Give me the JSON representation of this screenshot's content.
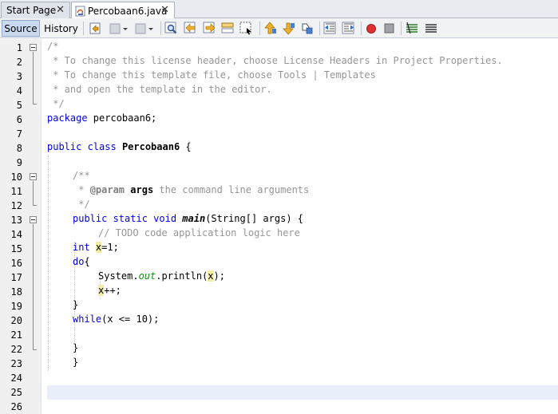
{
  "tabs": [
    {
      "label": "Start Page",
      "close": "✕"
    },
    {
      "label": "Percobaan6.java",
      "close": "✕"
    }
  ],
  "toolbar": {
    "source_label": "Source",
    "history_label": "History"
  },
  "line_numbers": [
    "1",
    "2",
    "3",
    "4",
    "5",
    "6",
    "7",
    "8",
    "9",
    "10",
    "11",
    "12",
    "13",
    "14",
    "15",
    "16",
    "17",
    "18",
    "19",
    "20",
    "21",
    "22",
    "23",
    "24",
    "25",
    "26"
  ],
  "code": {
    "l1": "/*",
    "l2": " * To change this license header, choose License Headers in Project Properties.",
    "l3": " * To change this template file, choose Tools | Templates",
    "l4": " * and open the template in the editor.",
    "l5": " */",
    "l6_kw": "package",
    "l6_rest": " percobaan6;",
    "l8_kw": "public class",
    "l8_name": "Percobaan6",
    "l8_rest": " {",
    "l10": "/**",
    "l11_a": " * ",
    "l11_tag": "@param",
    "l11_prm": "args",
    "l11_b": " the command line arguments",
    "l12": " */",
    "l13_kw": "public static void",
    "l13_name": "main",
    "l13_rest": "(String[] args) {",
    "l14": "// TODO code application logic here",
    "l15_kw": "int",
    "l15_var": "x",
    "l15_rest": "=1;",
    "l16_kw": "do",
    "l16_rest": "{",
    "l17_a": "System.",
    "l17_field": "out",
    "l17_b": ".println(",
    "l17_var": "x",
    "l17_c": ");",
    "l18_var": "x",
    "l18_rest": "++;",
    "l19": "}",
    "l20_kw": "while",
    "l20_rest": "(x <= 10);",
    "l22": "}",
    "l23": "}"
  },
  "toolbar_icons": [
    "last-edit-icon",
    "back-icon",
    "forward-icon",
    "find-icon",
    "find-previous-icon",
    "find-next-icon",
    "toggle-highlight-icon",
    "toggle-rectangular-selection-icon",
    "previous-bookmark-icon",
    "next-bookmark-icon",
    "toggle-bookmark-icon",
    "shift-left-icon",
    "shift-right-icon",
    "start-macro-icon",
    "stop-macro-icon",
    "comment-icon",
    "uncomment-icon"
  ],
  "colors": {
    "keyword": "#0000e6",
    "comment": "#969696",
    "static_field": "#009900",
    "occurrence_highlight": "#f2eea3",
    "current_line": "#e9effa",
    "active_toggle": "#c9d9ef"
  }
}
